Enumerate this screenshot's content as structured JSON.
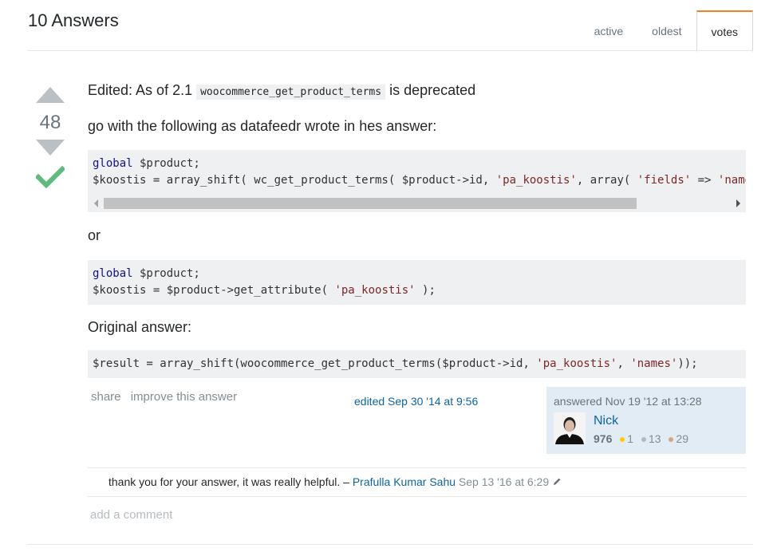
{
  "header": {
    "title": "10 Answers",
    "tabs": [
      {
        "label": "active"
      },
      {
        "label": "oldest"
      },
      {
        "label": "votes",
        "selected": true
      }
    ]
  },
  "vote": {
    "count": "48",
    "accepted": true,
    "upvote_icon": "upvote-arrow-icon",
    "downvote_icon": "downvote-arrow-icon",
    "accepted_icon": "checkmark-icon"
  },
  "post": {
    "p1_prefix": "Edited: As of 2.1",
    "p1_code": "woocommerce_get_product_terms",
    "p1_suffix": "is deprecated",
    "p2": "go with the following as datafeedr wrote in hes answer:",
    "code1": {
      "line1_kw": "global",
      "line1_rest": " $product;",
      "line2_a": "$koostis = array_shift( wc_get_product_terms( $product->id, ",
      "line2_s1": "'pa_koostis'",
      "line2_b": ", array( ",
      "line2_s2": "'fields'",
      "line2_c": " => ",
      "line2_s3": "'names'",
      "line2_d": " ) ) );"
    },
    "p3": "or",
    "code2": {
      "line1_kw": "global",
      "line1_rest": " $product;",
      "line2_a": "$koostis = $product->get_attribute( ",
      "line2_s1": "'pa_koostis'",
      "line2_b": " );"
    },
    "p4": "Original answer:",
    "code3": {
      "a": "$result = array_shift(woocommerce_get_product_terms($product->id, ",
      "s1": "'pa_koostis'",
      "b": ", ",
      "s2": "'names'",
      "c": "));"
    }
  },
  "post_menu": {
    "share": "share",
    "improve": "improve this answer"
  },
  "edited": "edited Sep 30 '14 at 9:56",
  "owner": {
    "time": "answered Nov 19 '12 at 13:28",
    "name": "Nick",
    "reputation": "976",
    "gold": "1",
    "silver": "13",
    "bronze": "29",
    "badge_colors": {
      "gold": "#ffcc01",
      "silver": "#b4b8bc",
      "bronze": "#d1a684"
    }
  },
  "comments": [
    {
      "text": "thank you for your answer, it was really helpful.",
      "dash": " – ",
      "user": "Prafulla Kumar Sahu",
      "date": "Sep 13 '16 at 6:29",
      "edit_icon": "pencil-icon"
    }
  ],
  "add_comment": "add a comment"
}
